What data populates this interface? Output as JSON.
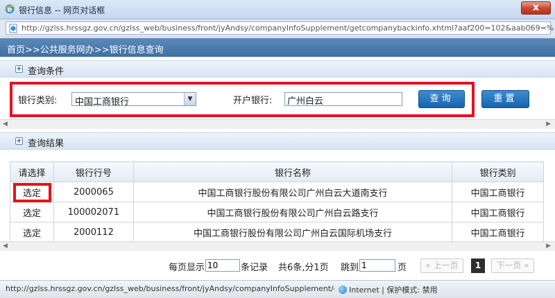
{
  "window": {
    "title": "银行信息 -- 网页对话框",
    "close_label": "x",
    "url": "http://gzlss.hrssgz.gov.cn/gzlss_web/business/front/jyAndsy/companyInfoSupplement/getcompanybackinfo.xhtml?aaf200=102&aab069=%"
  },
  "breadcrumb": "首页>>公共服务网办>>银行信息查询",
  "query_section": {
    "title": "查询条件",
    "bank_type_label": "银行类别:",
    "bank_type_value": "中国工商银行",
    "open_bank_label": "开户银行:",
    "open_bank_value": "广州白云",
    "search_label": "查询",
    "reset_label": "重置"
  },
  "results_section": {
    "title": "查询结果",
    "columns": [
      "请选择",
      "银行行号",
      "银行名称",
      "银行类别"
    ],
    "rows": [
      {
        "select": "选定",
        "code": "2000065",
        "name": "中国工商银行股份有限公司广州白云大道南支行",
        "type": "中国工商银行"
      },
      {
        "select": "选定",
        "code": "100002071",
        "name": "中国工商银行股份有限公司广州白云路支行",
        "type": "中国工商银行"
      },
      {
        "select": "选定",
        "code": "2000112",
        "name": "中国工商银行股份有限公司广州白云国际机场支行",
        "type": "中国工商银行"
      }
    ]
  },
  "pager": {
    "per_page_prefix": "每页显示",
    "per_page_value": "10",
    "per_page_suffix": "条记录",
    "summary": "共6条,分1页",
    "goto_prefix": "跳到",
    "goto_value": "1",
    "goto_suffix": "页",
    "prev_label": "« 上一页",
    "current_page": "1",
    "next_label": "下一页 »"
  },
  "statusbar": {
    "url": "http://gzlss.hrssgz.gov.cn/gzlss_web/business/front/jyAndsy/companyInfoSupplement/g",
    "zone": "Internet | 保护模式: 禁用"
  }
}
